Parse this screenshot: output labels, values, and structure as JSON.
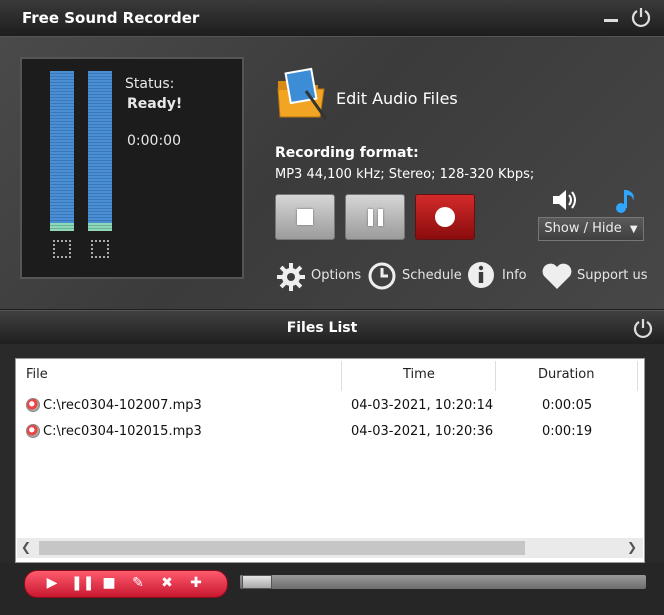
{
  "app": {
    "title": "Free Sound Recorder"
  },
  "recorder": {
    "status_label": "Status:",
    "status_value": "Ready!",
    "elapsed": "0:00:00",
    "edit_label": "Edit Audio Files",
    "format_label": "Recording format:",
    "format_value": "MP3 44,100 kHz; Stereo;  128-320 Kbps;",
    "show_hide": "Show / Hide"
  },
  "tools": {
    "options": "Options",
    "schedule": "Schedule",
    "info": "Info",
    "support": "Support us"
  },
  "files": {
    "title": "Files List",
    "columns": [
      "File",
      "Time",
      "Duration"
    ],
    "rows": [
      {
        "file": "C:\\rec0304-102007.mp3",
        "time": "04-03-2021, 10:20:14",
        "duration": "0:00:05"
      },
      {
        "file": "C:\\rec0304-102015.mp3",
        "time": "04-03-2021, 10:20:36",
        "duration": "0:00:19"
      }
    ]
  },
  "colors": {
    "accent_red": "#c81830",
    "meter_blue": "#4a8fd4",
    "panel_bg": "#1c1c1c"
  },
  "icons": [
    "minimize-icon",
    "power-icon",
    "speaker-icon",
    "music-note-icon",
    "gear-icon",
    "clock-icon",
    "info-icon",
    "heart-icon"
  ]
}
